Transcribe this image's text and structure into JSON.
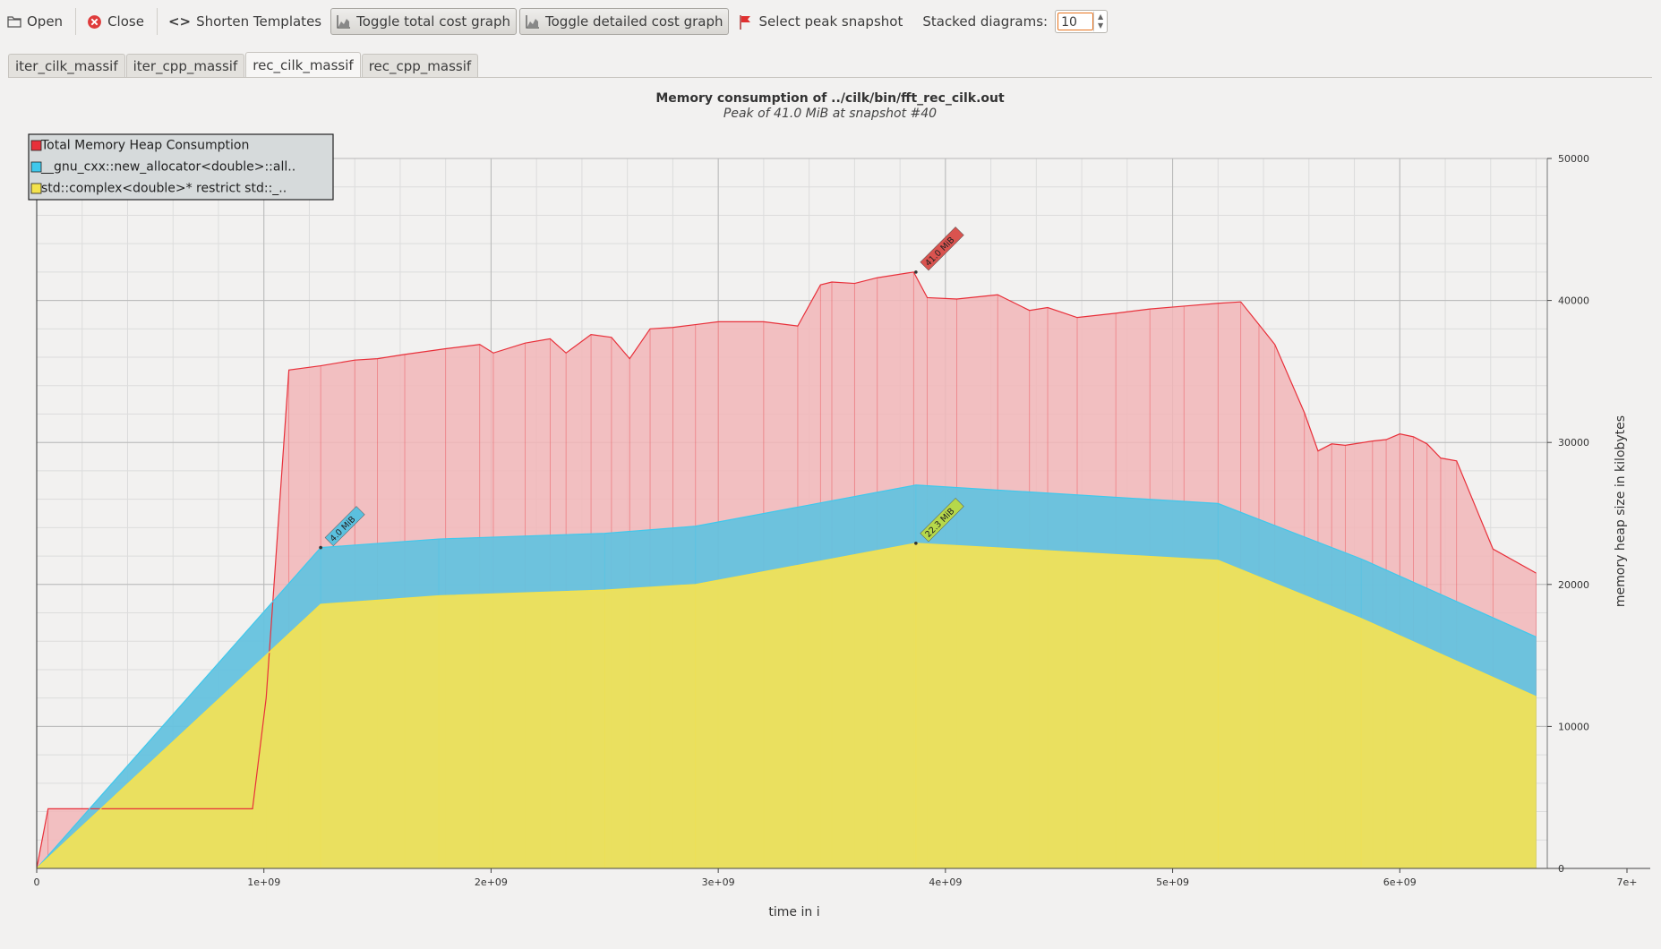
{
  "toolbar": {
    "open": "Open",
    "close": "Close",
    "shorten": "Shorten Templates",
    "toggle_total": "Toggle total cost graph",
    "toggle_detailed": "Toggle detailed cost graph",
    "select_peak": "Select peak snapshot",
    "stacked_label": "Stacked diagrams:",
    "stacked_value": "10"
  },
  "tabs": [
    {
      "label": "iter_cilk_massif"
    },
    {
      "label": "iter_cpp_massif"
    },
    {
      "label": "rec_cilk_massif"
    },
    {
      "label": "rec_cpp_massif"
    }
  ],
  "active_tab": "rec_cilk_massif",
  "colors": {
    "total": "#e8303a",
    "total_fill": "#f2b6b8",
    "allocator": "#3fc8ec",
    "allocator_fill": "#65c2de",
    "complex": "#f3e24c",
    "complex_fill": "#f1e157"
  },
  "chart_data": {
    "type": "area",
    "title": "Memory consumption of ../cilk/bin/fft_rec_cilk.out",
    "subtitle": "Peak of 41.0 MiB at snapshot #40",
    "xlabel": "time in i",
    "ylabel": "memory heap size in kilobytes",
    "xlim": [
      0,
      7000000000
    ],
    "ylim": [
      0,
      50000
    ],
    "x_ticks": [
      "0",
      "1e+09",
      "2e+09",
      "3e+09",
      "4e+09",
      "5e+09",
      "6e+09",
      "7e+"
    ],
    "y_ticks": [
      "0",
      "10000",
      "20000",
      "30000",
      "40000",
      "50000"
    ],
    "legend": [
      {
        "name": "Total Memory Heap Consumption",
        "color": "#e8303a"
      },
      {
        "name": "__gnu_cxx::new_allocator<double>::all..",
        "color": "#3fc8ec"
      },
      {
        "name": "std::complex<double>* restrict std::_..",
        "color": "#f3e24c"
      }
    ],
    "legend_position": "top-left",
    "grid": true,
    "series": [
      {
        "name": "Total Memory Heap Consumption",
        "x": [
          0,
          50000000,
          950000000,
          1010000000,
          1110000000,
          1250000000,
          1400000000,
          1500000000,
          1620000000,
          1800000000,
          1950000000,
          2010000000,
          2150000000,
          2260000000,
          2330000000,
          2440000000,
          2530000000,
          2610000000,
          2700000000,
          2800000000,
          2900000000,
          3000000000,
          3200000000,
          3350000000,
          3450000000,
          3500000000,
          3600000000,
          3700000000,
          3860000000,
          3920000000,
          4050000000,
          4230000000,
          4370000000,
          4450000000,
          4580000000,
          4750000000,
          4900000000,
          5050000000,
          5200000000,
          5300000000,
          5380000000,
          5450000000,
          5580000000,
          5640000000,
          5700000000,
          5760000000,
          5880000000,
          5940000000,
          6000000000,
          6060000000,
          6120000000,
          6180000000,
          6250000000,
          6410000000,
          6600000000
        ],
        "values": [
          0,
          4200,
          4200,
          12000,
          35100,
          35400,
          35800,
          35900,
          36200,
          36600,
          36900,
          36300,
          37000,
          37300,
          36300,
          37600,
          37400,
          35900,
          38000,
          38100,
          38300,
          38500,
          38500,
          38200,
          41100,
          41300,
          41200,
          41600,
          42000,
          40200,
          40100,
          40400,
          39300,
          39500,
          38800,
          39100,
          39400,
          39600,
          39800,
          39900,
          38300,
          36900,
          32100,
          29400,
          29900,
          29800,
          30100,
          30200,
          30600,
          30400,
          29900,
          28900,
          28700,
          22500,
          20800
        ]
      },
      {
        "name": "__gnu_cxx::new_allocator<double>::all..",
        "x": [
          0,
          1250000000,
          1770000000,
          2500000000,
          2900000000,
          3870000000,
          5200000000,
          5830000000,
          6600000000
        ],
        "values": [
          0,
          22600,
          23200,
          23600,
          24100,
          27000,
          25700,
          21800,
          16300
        ]
      },
      {
        "name": "std::complex<double>* restrict std::_..",
        "x": [
          0,
          1250000000,
          1770000000,
          2500000000,
          2900000000,
          3870000000,
          5200000000,
          5830000000,
          6600000000
        ],
        "values": [
          0,
          18600,
          19200,
          19600,
          20000,
          22900,
          21700,
          17600,
          12100
        ]
      }
    ],
    "annotations": [
      {
        "label": "41.0 MiB",
        "x": 3870000000,
        "y": 42000,
        "series": "Total Memory Heap Consumption"
      },
      {
        "label": "4.0 MiB",
        "x": 1250000000,
        "y": 22600,
        "series": "__gnu_cxx::new_allocator<double>::all.."
      },
      {
        "label": "22.3 MiB",
        "x": 3870000000,
        "y": 22900,
        "series": "std::complex<double>* restrict std::_.."
      }
    ]
  }
}
